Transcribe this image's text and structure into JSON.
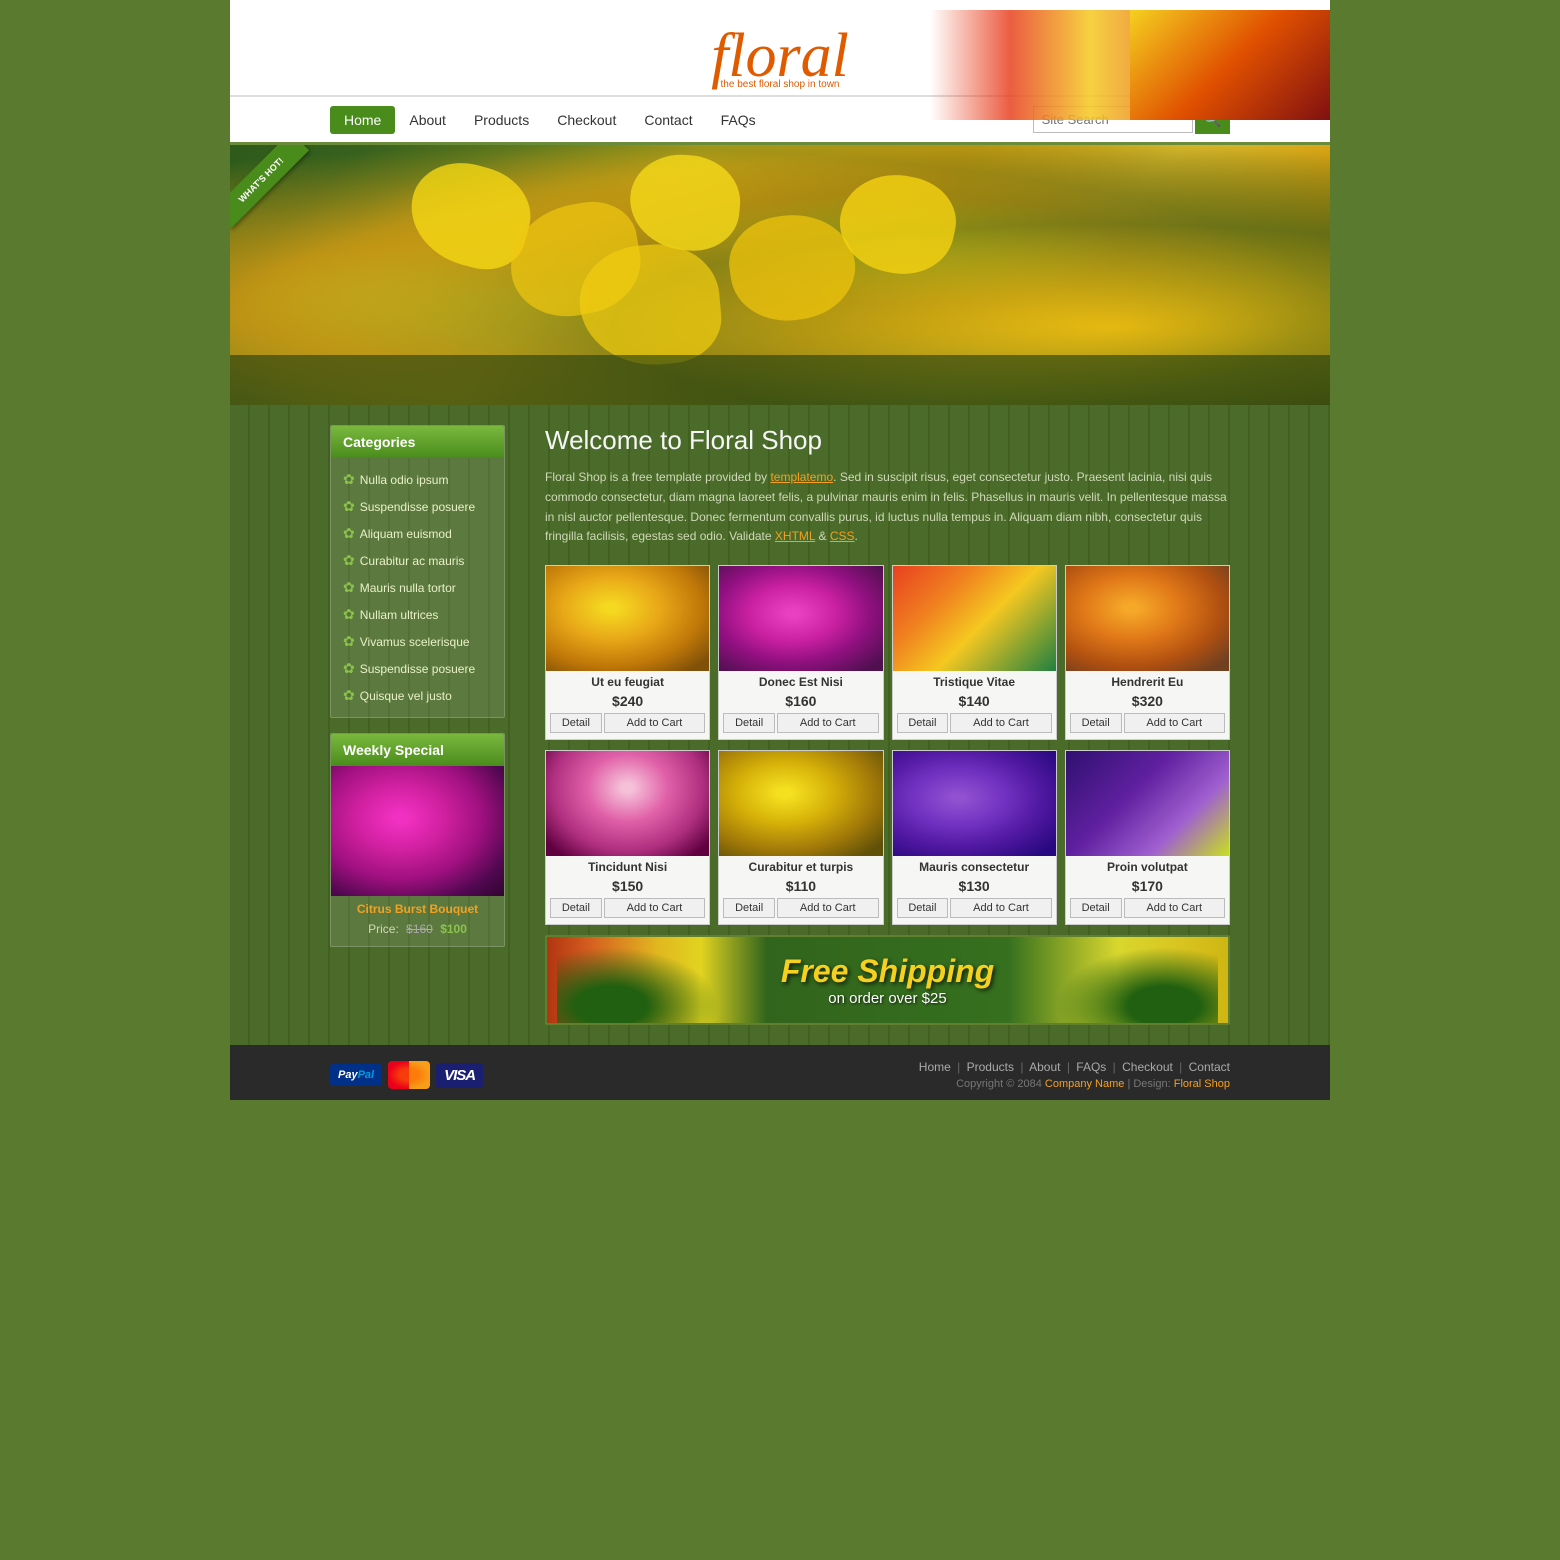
{
  "site": {
    "logo": "floral",
    "tagline": "the best floral shop in town"
  },
  "nav": {
    "items": [
      "Home",
      "About",
      "Products",
      "Checkout",
      "Contact",
      "FAQs"
    ],
    "active": "Home",
    "search_placeholder": "Site Search"
  },
  "banner": {
    "ribbon_text": "WHAT'S HOT!"
  },
  "welcome": {
    "title": "Welcome to Floral Shop",
    "body": "Floral Shop is a free template provided by templatemo. Sed in suscipit risus, eget consectetur justo. Praesent lacinia, nisi quis commodo consectetur, diam magna laoreet felis, a pulvinar mauris enim in felis. Phasellus in mauris velit. In pellentesque massa in nisl auctor pellentesque. Donec fermentum convallis purus, id luctus nulla tempus in. Aliquam diam nibh, consectetur quis fringilla facilisis, egestas sed odio. Validate",
    "link1": "XHTML",
    "ampersand": " & ",
    "link2": "CSS",
    "end": "."
  },
  "sidebar": {
    "categories_title": "Categories",
    "categories": [
      "Nulla odio ipsum",
      "Suspendisse posuere",
      "Aliquam euismod",
      "Curabitur ac mauris",
      "Mauris nulla tortor",
      "Nullam ultrices",
      "Vivamus scelerisque",
      "Suspendisse posuere",
      "Quisque vel justo"
    ],
    "weekly_title": "Weekly Special",
    "weekly_name": "Citrus Burst Bouquet",
    "weekly_price_label": "Price:",
    "weekly_old_price": "$160",
    "weekly_new_price": "$100"
  },
  "products": {
    "row1": [
      {
        "name": "Ut eu feugiat",
        "price": "$240"
      },
      {
        "name": "Donec Est Nisi",
        "price": "$160"
      },
      {
        "name": "Tristique Vitae",
        "price": "$140"
      },
      {
        "name": "Hendrerit Eu",
        "price": "$320"
      }
    ],
    "row2": [
      {
        "name": "Tincidunt Nisi",
        "price": "$150"
      },
      {
        "name": "Curabitur et turpis",
        "price": "$110"
      },
      {
        "name": "Mauris consectetur",
        "price": "$130"
      },
      {
        "name": "Proin volutpat",
        "price": "$170"
      }
    ],
    "btn_detail": "Detail",
    "btn_cart": "Add to Cart"
  },
  "shipping": {
    "main": "Free Shipping",
    "sub": "on order over $25"
  },
  "footer": {
    "links": [
      "Home",
      "Products",
      "About",
      "FAQs",
      "Checkout",
      "Contact"
    ],
    "copyright": "Copyright © 2084",
    "company": "Company Name",
    "design_label": "| Design:",
    "design_link": "Floral Shop"
  }
}
